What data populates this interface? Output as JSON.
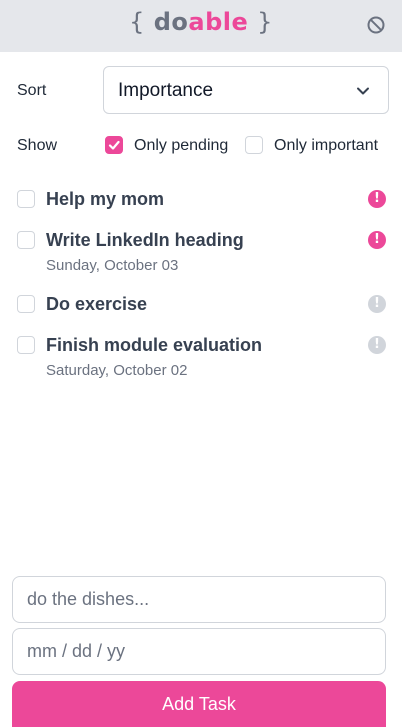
{
  "header": {
    "logo_open": "{",
    "logo_do": "do",
    "logo_able": "able",
    "logo_close": "}",
    "logout_icon": "block-icon"
  },
  "controls": {
    "sort_label": "Sort",
    "sort_value": "Importance",
    "show_label": "Show",
    "only_pending_label": "Only pending",
    "only_pending_checked": true,
    "only_important_label": "Only important",
    "only_important_checked": false
  },
  "tasks": [
    {
      "title": "Help my mom",
      "date": "",
      "important": true
    },
    {
      "title": "Write LinkedIn heading",
      "date": "Sunday, October 03",
      "important": true
    },
    {
      "title": "Do exercise",
      "date": "",
      "important": false
    },
    {
      "title": "Finish module evaluation",
      "date": "Saturday, October 02",
      "important": false
    }
  ],
  "form": {
    "task_placeholder": "do the dishes...",
    "date_placeholder": "mm / dd / yy",
    "submit_label": "Add Task"
  },
  "colors": {
    "accent": "#ec4899",
    "header_bg": "#e5e7eb",
    "muted": "#d1d5db"
  }
}
